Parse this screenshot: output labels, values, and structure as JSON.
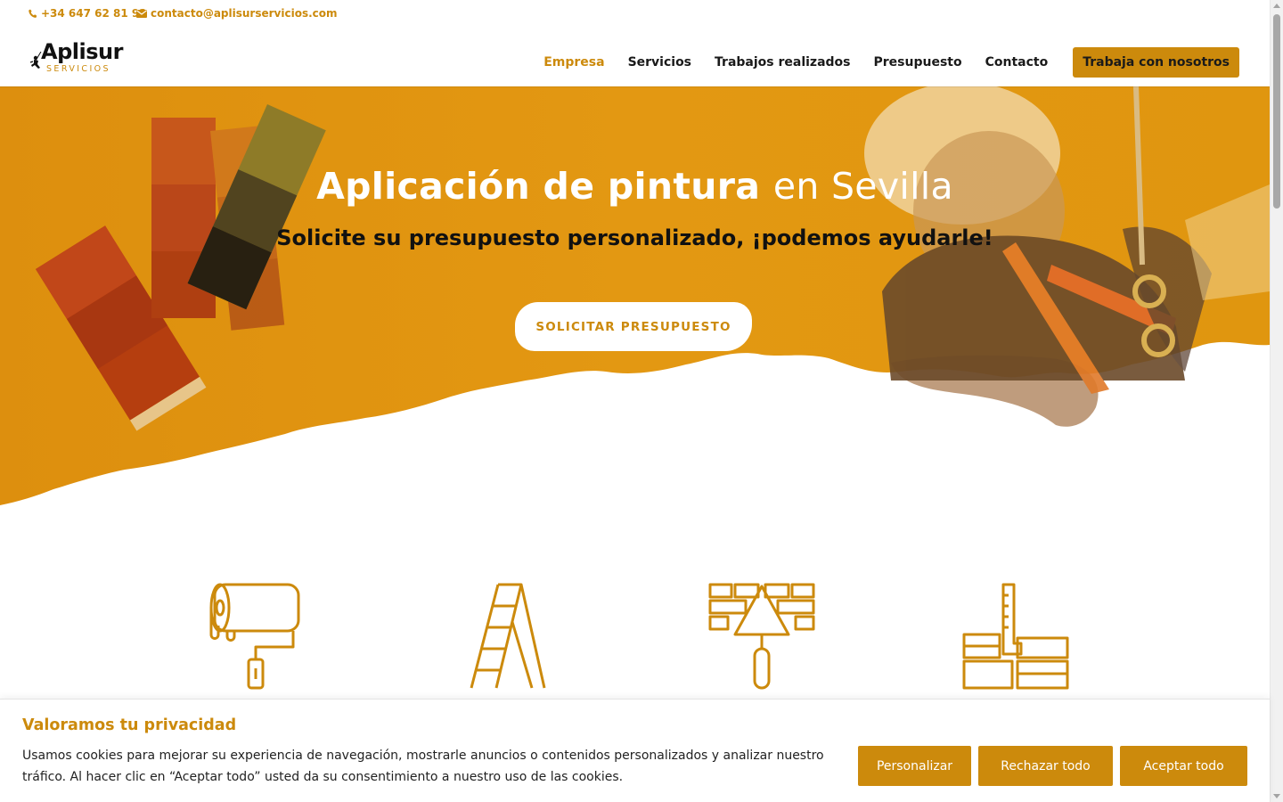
{
  "topbar": {
    "phone": "+34 647 62 81 92",
    "email": "contacto@aplisurservicios.com"
  },
  "brand": {
    "name": "Aplisur",
    "subtitle": "SERVICIOS"
  },
  "nav": {
    "items": [
      "Empresa",
      "Servicios",
      "Trabajos realizados",
      "Presupuesto",
      "Contacto"
    ],
    "active": "Empresa",
    "cta": "Trabaja con nosotros"
  },
  "hero": {
    "title_bold": "Aplicación de pintura",
    "title_light": "en Sevilla",
    "subtitle": "Solicite su presupuesto personalizado, ¡podemos ayudarle!",
    "button": "SOLICITAR PRESUPUESTO"
  },
  "icons": [
    "paint-roller-icon",
    "ladder-icon",
    "trowel-bricks-icon",
    "square-ruler-bricks-icon"
  ],
  "cookie": {
    "title": "Valoramos tu privacidad",
    "text": "Usamos cookies para mejorar su experiencia de navegación, mostrarle anuncios o contenidos personalizados y analizar nuestro tráfico. Al hacer clic en “Aceptar todo” usted da su consentimiento a nuestro uso de las cookies.",
    "customize": "Personalizar",
    "reject": "Rechazar todo",
    "accept": "Aceptar todo"
  },
  "colors": {
    "accent": "#cc8a0c",
    "hero_orange": "#e09412",
    "text_dark": "#1a1a1a"
  }
}
